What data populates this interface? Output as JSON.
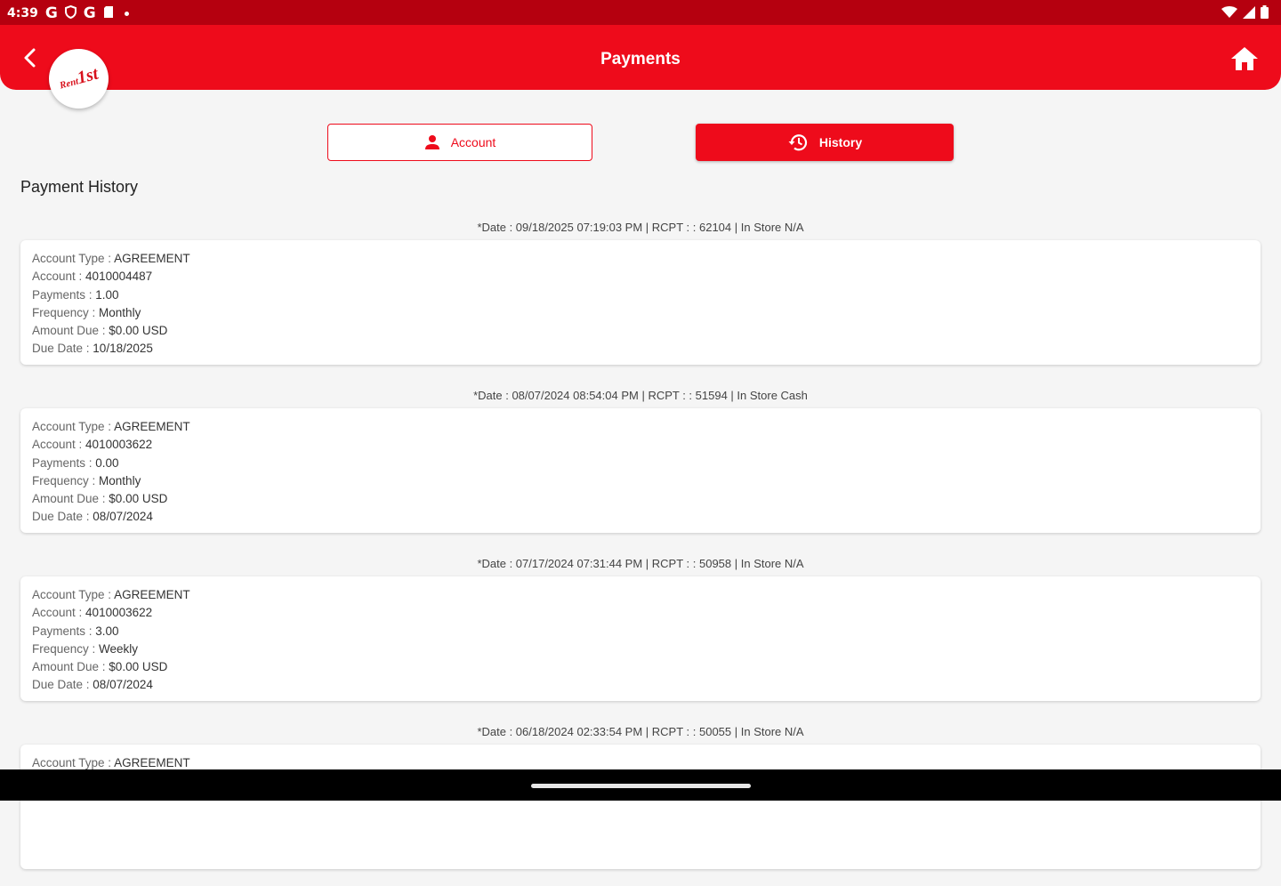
{
  "status_bar": {
    "time": "4:39",
    "notif_icons": [
      "G",
      "G"
    ]
  },
  "app_bar": {
    "title": "Payments",
    "logo_text": "Rent",
    "logo_mark": "1st"
  },
  "tabs": {
    "account_label": "Account",
    "history_label": "History"
  },
  "section_title": "Payment History",
  "labels": {
    "account_type": "Account Type : ",
    "account": "Account : ",
    "payments": "Payments : ",
    "frequency": "Frequency : ",
    "amount_due": "Amount Due : ",
    "due_date": "Due Date : "
  },
  "history": [
    {
      "header": "*Date : 09/18/2025 07:19:03 PM | RCPT : : 62104 | In Store N/A",
      "account_type": "AGREEMENT",
      "account": "4010004487",
      "payments": "1.00",
      "frequency": "Monthly",
      "amount_due": "$0.00 USD",
      "due_date": "10/18/2025"
    },
    {
      "header": "*Date : 08/07/2024 08:54:04 PM | RCPT : : 51594 | In Store Cash",
      "account_type": "AGREEMENT",
      "account": "4010003622",
      "payments": "0.00",
      "frequency": "Monthly",
      "amount_due": "$0.00 USD",
      "due_date": "08/07/2024"
    },
    {
      "header": "*Date : 07/17/2024 07:31:44 PM | RCPT : : 50958 | In Store N/A",
      "account_type": "AGREEMENT",
      "account": "4010003622",
      "payments": "3.00",
      "frequency": "Weekly",
      "amount_due": "$0.00 USD",
      "due_date": "08/07/2024"
    },
    {
      "header": "*Date : 06/18/2024 02:33:54 PM | RCPT : : 50055 | In Store N/A",
      "account_type": "AGREEMENT"
    }
  ],
  "colors": {
    "brand_red": "#ee0b1b",
    "status_red": "#b5000f"
  }
}
